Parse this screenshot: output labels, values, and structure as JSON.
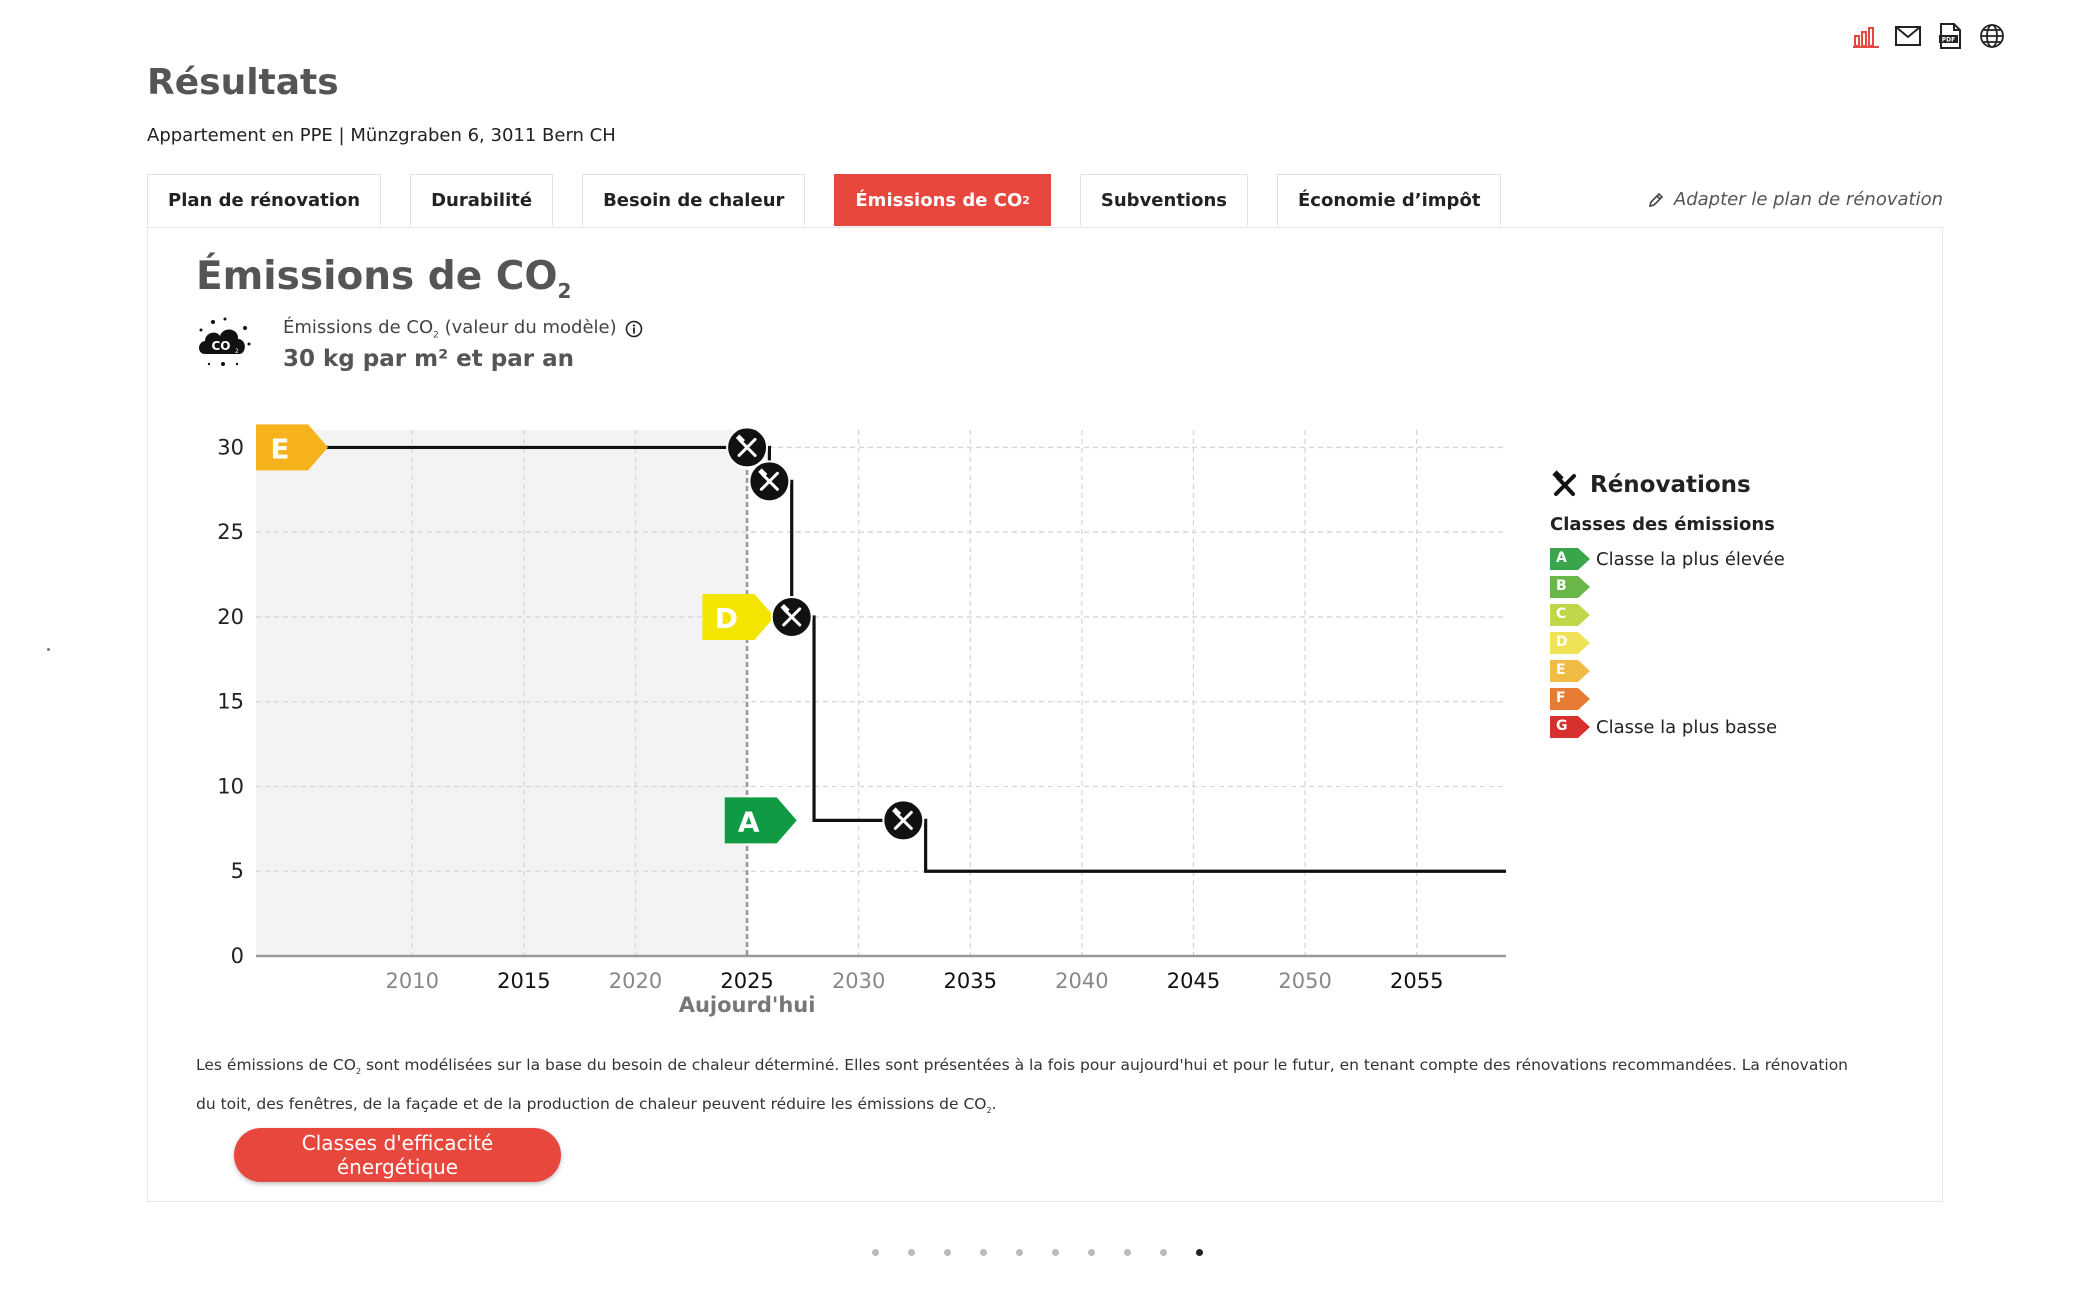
{
  "header": {
    "title": "Résultats",
    "address": "Appartement en PPE | Münzgraben 6, 3011 Bern CH",
    "icons": [
      "chart-icon",
      "mail-icon",
      "pdf-icon",
      "globe-icon"
    ],
    "adapt_link": "Adapter le plan de rénovation"
  },
  "tabs": [
    {
      "label": "Plan de rénovation"
    },
    {
      "label": "Durabilité"
    },
    {
      "label": "Besoin de chaleur"
    },
    {
      "label": "Émissions de CO",
      "sub": "2",
      "active": true
    },
    {
      "label": "Subventions"
    },
    {
      "label": "Économie d’impôt"
    }
  ],
  "section": {
    "title": "Émissions de CO",
    "title_sub": "2",
    "cloud_label": "CO",
    "cloud_sub": "2",
    "metric_label_pre": "Émissions de CO",
    "metric_label_sub": "2",
    "metric_label_post": "(valeur du modèle)",
    "metric_value": "30 kg par m² et par an"
  },
  "chart_data": {
    "type": "line",
    "step": true,
    "x_range": [
      2003,
      2059
    ],
    "ylim": [
      0,
      31.5
    ],
    "yticks": [
      0,
      5,
      10,
      15,
      20,
      25,
      30
    ],
    "xticks": [
      2010,
      2015,
      2020,
      2025,
      2030,
      2035,
      2040,
      2045,
      2050,
      2055
    ],
    "today": 2025,
    "today_label": "Aujourd'hui",
    "past_shaded": true,
    "series": [
      {
        "points": [
          [
            2003,
            30
          ],
          [
            2025,
            30
          ],
          [
            2026,
            28
          ],
          [
            2027,
            20
          ],
          [
            2028,
            8
          ],
          [
            2033,
            5
          ],
          [
            2059,
            5
          ]
        ]
      }
    ],
    "renovations": [
      {
        "year": 2025,
        "y": 30
      },
      {
        "year": 2026,
        "y": 28
      },
      {
        "year": 2027,
        "y": 20
      },
      {
        "year": 2032,
        "y": 8
      }
    ],
    "class_markers": [
      {
        "label": "E",
        "x": 2003,
        "y": 30,
        "color": "#f5b21b"
      },
      {
        "label": "D",
        "x": 2023,
        "y": 20,
        "color": "#f3e500"
      },
      {
        "label": "A",
        "x": 2024,
        "y": 8,
        "color": "#0f9a43"
      }
    ],
    "grid": true
  },
  "legend": {
    "title": "Rénovations",
    "subtitle": "Classes des émissions",
    "classes": [
      {
        "label": "A",
        "color": "#3aa54a",
        "text": "Classe la plus élevée"
      },
      {
        "label": "B",
        "color": "#69b649",
        "text": ""
      },
      {
        "label": "C",
        "color": "#c2d64a",
        "text": ""
      },
      {
        "label": "D",
        "color": "#f0e257",
        "text": ""
      },
      {
        "label": "E",
        "color": "#f0bc45",
        "text": ""
      },
      {
        "label": "F",
        "color": "#e67c34",
        "text": ""
      },
      {
        "label": "G",
        "color": "#d8302e",
        "text": "Classe la plus basse"
      }
    ]
  },
  "note": {
    "part1": "Les émissions de CO",
    "sub1": "2",
    "part2": " sont modélisées sur la base du besoin de chaleur déterminé. Elles sont présentées à la fois pour aujourd'hui et pour le futur, en tenant compte des rénovations recommandées. La rénovation du toit, des fenêtres, de la façade et de la production de chaleur peuvent réduire les émissions de CO",
    "sub2": "2",
    "part3": "."
  },
  "cta": {
    "label": "Classes d'efficacité énergétique"
  },
  "pagination": {
    "count": 10,
    "active": 9
  }
}
